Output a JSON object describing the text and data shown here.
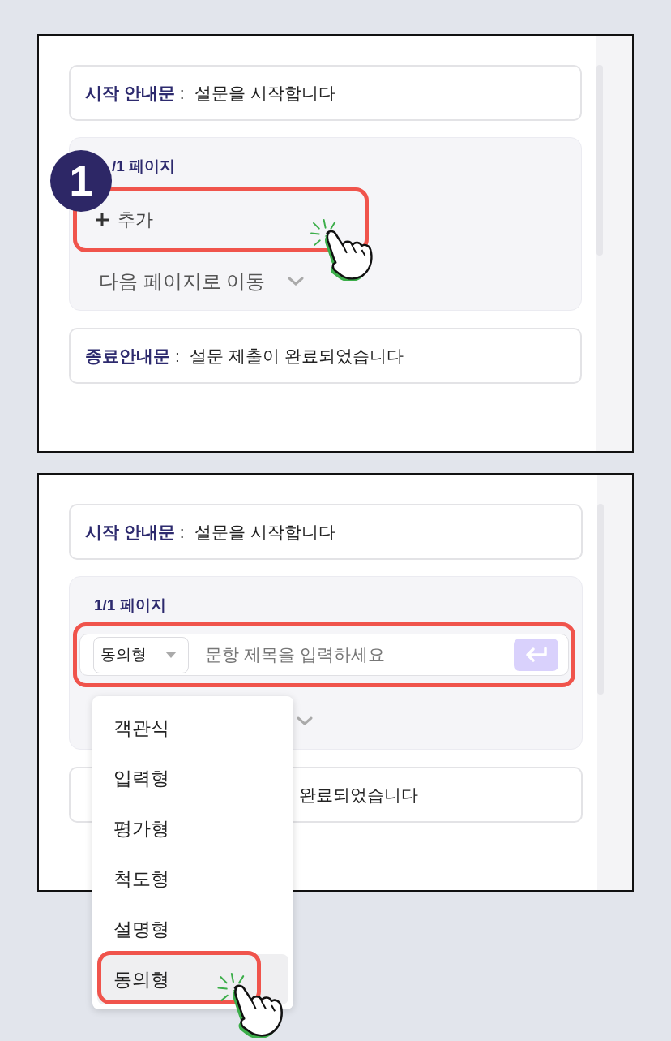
{
  "panels": [
    {
      "kind": "add",
      "start_notice": {
        "label": "시작 안내문",
        "separator": ":",
        "text": "설문을 시작합니다"
      },
      "page": {
        "title": "/1 페이지",
        "add_label": "추가",
        "next_action": "다음 페이지로 이동"
      },
      "end_notice": {
        "label": "종료안내문",
        "separator": ":",
        "text": "설문 제출이 완료되었습니다"
      },
      "step_badge": "1"
    },
    {
      "kind": "input",
      "start_notice": {
        "label": "시작 안내문",
        "separator": ":",
        "text": "설문을 시작합니다"
      },
      "page": {
        "title": "1/1 페이지",
        "question_type": "동의형",
        "placeholder": "문항 제목을 입력하세요"
      },
      "end_notice": {
        "text": "완료되었습니다"
      },
      "type_menu": [
        {
          "label": "객관식",
          "selected": false
        },
        {
          "label": "입력형",
          "selected": false
        },
        {
          "label": "평가형",
          "selected": false
        },
        {
          "label": "척도형",
          "selected": false
        },
        {
          "label": "설명형",
          "selected": false
        },
        {
          "label": "동의형",
          "selected": true
        }
      ]
    }
  ]
}
